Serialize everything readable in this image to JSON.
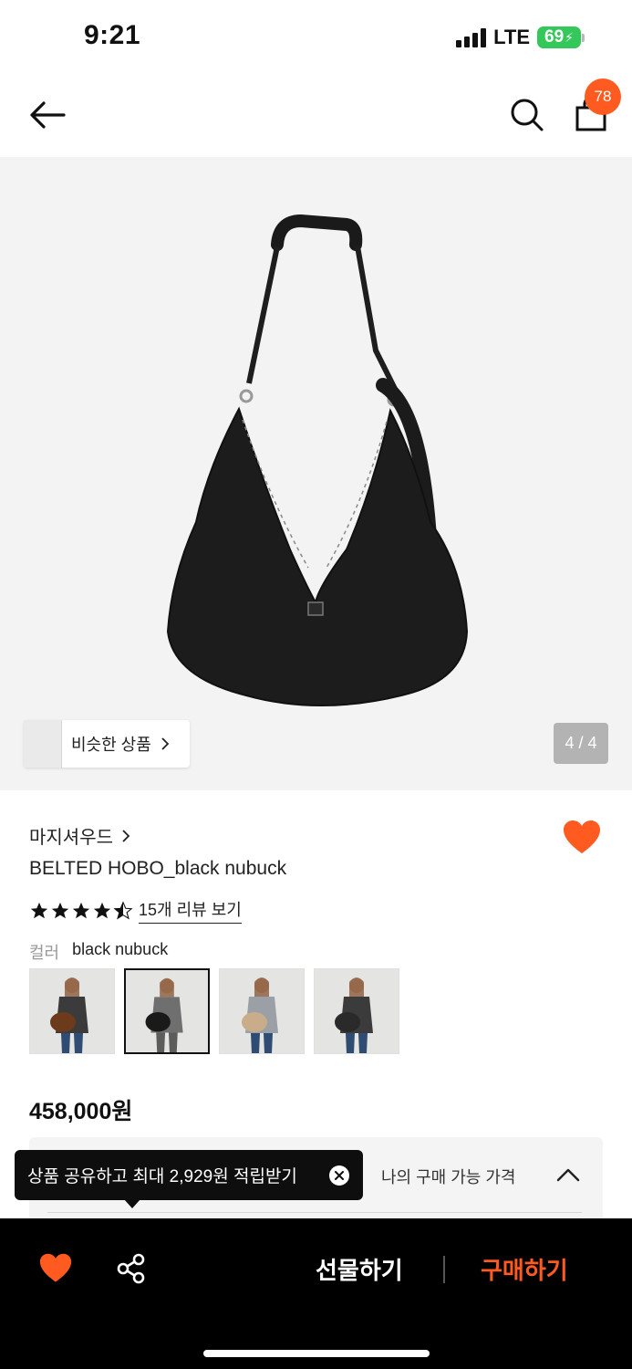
{
  "status_bar": {
    "time": "9:21",
    "network": "LTE",
    "battery": "69"
  },
  "header": {
    "cart_count": "78",
    "icons": [
      "back-arrow-icon",
      "search-icon",
      "shopping-bag-icon"
    ]
  },
  "gallery": {
    "similar_label": "비슷한 상품",
    "page_indicator": "4 / 4"
  },
  "product": {
    "brand": "마지셔우드",
    "title": "BELTED HOBO_black nubuck",
    "rating": 4.5,
    "review_link": "15개 리뷰 보기",
    "color_label": "컬러",
    "color_value": "black nubuck",
    "color_options": [
      {
        "bag_color": "#6b3b1c",
        "selected": false
      },
      {
        "bag_color": "#1a1a1a",
        "selected": true
      },
      {
        "bag_color": "#c9ad8a",
        "selected": false
      },
      {
        "bag_color": "#2a2a2a",
        "selected": false
      }
    ],
    "price": "458,000원"
  },
  "price_panel": {
    "label": "나의 구매 가능 가격"
  },
  "tooltip": {
    "text": "상품 공유하고 최대 2,929원 적립받기"
  },
  "bottom_bar": {
    "gift_label": "선물하기",
    "buy_label": "구매하기"
  },
  "colors": {
    "accent": "#ff5a1f",
    "battery": "#34c759"
  }
}
